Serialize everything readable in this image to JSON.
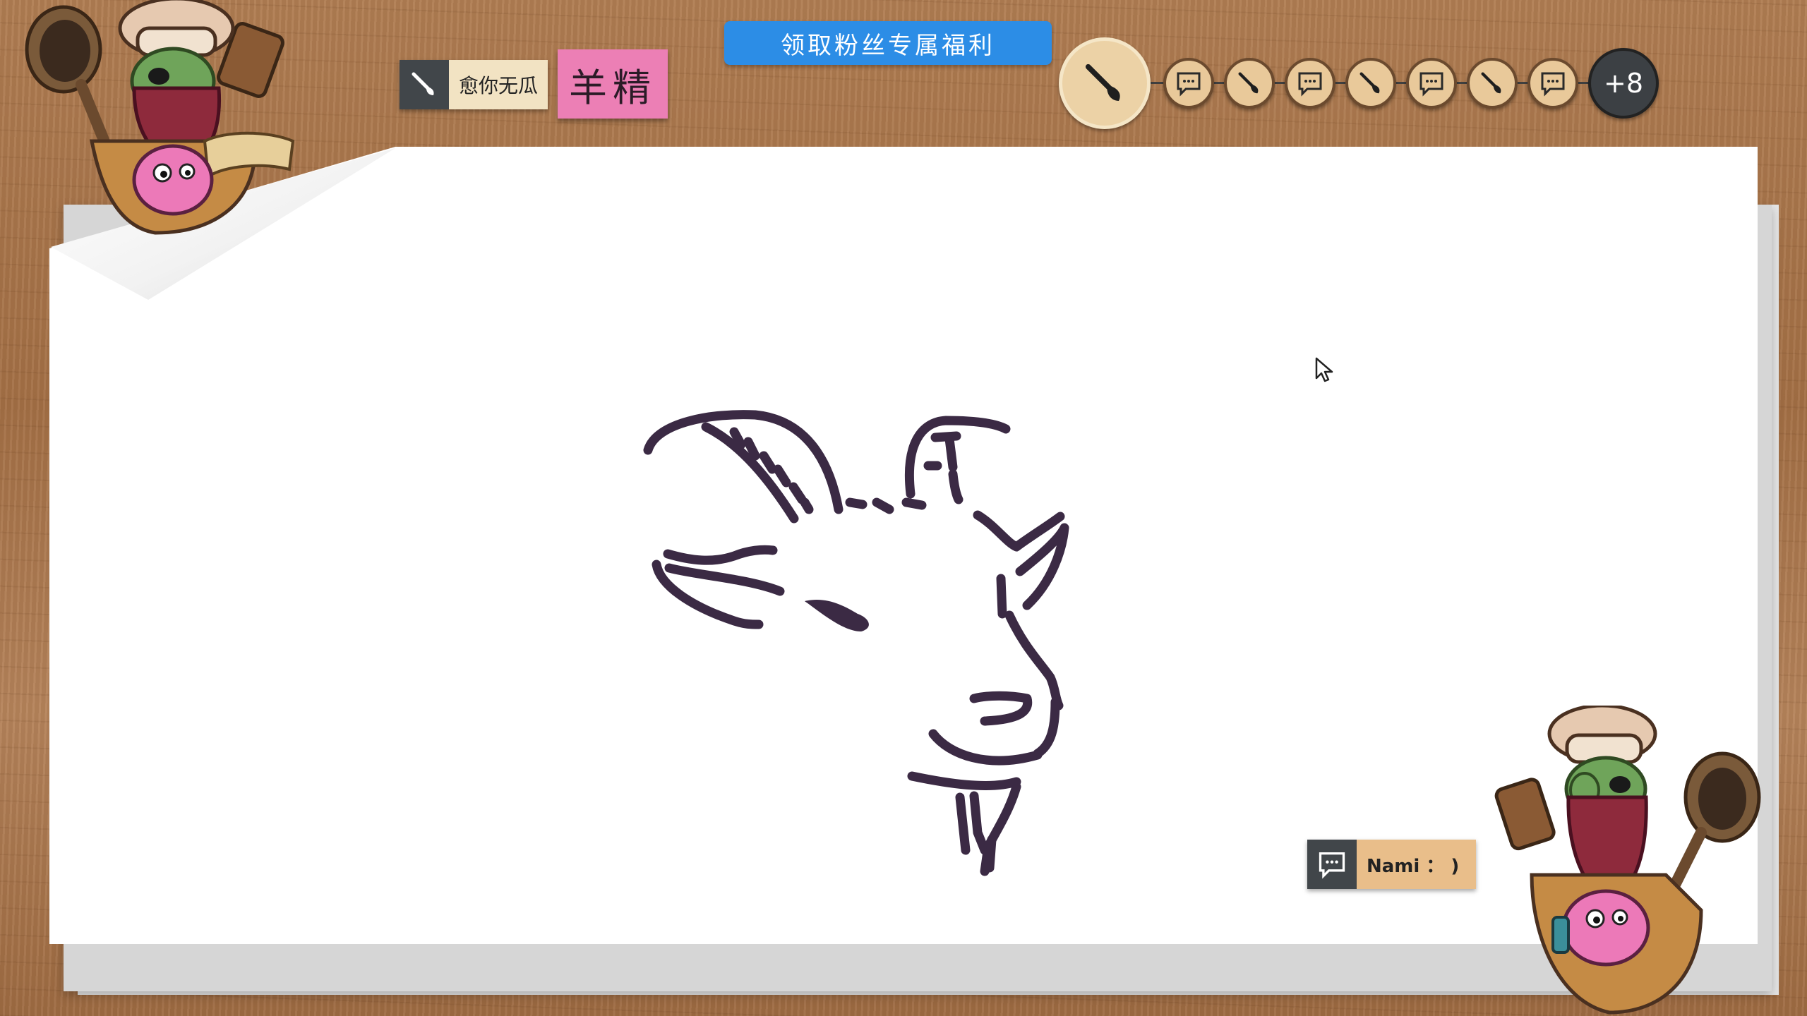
{
  "banner": {
    "label": "领取粉丝专属福利"
  },
  "current_drawer": {
    "name": "愈你无瓜",
    "icon": "brush-icon"
  },
  "word_hint": {
    "text": "羊精"
  },
  "player_queue": {
    "nodes": [
      {
        "type": "drawer",
        "icon": "brush-icon",
        "current": true
      },
      {
        "type": "chat",
        "icon": "chat-bubble-icon"
      },
      {
        "type": "drawer",
        "icon": "brush-icon"
      },
      {
        "type": "chat",
        "icon": "chat-bubble-icon"
      },
      {
        "type": "drawer",
        "icon": "brush-icon"
      },
      {
        "type": "chat",
        "icon": "chat-bubble-icon"
      },
      {
        "type": "drawer",
        "icon": "brush-icon"
      },
      {
        "type": "chat",
        "icon": "chat-bubble-icon"
      }
    ],
    "more_label": "+8"
  },
  "chat_message": {
    "icon": "chat-bubble-icon",
    "text": "Nami ： )"
  },
  "colors": {
    "stroke": "#3b2a44",
    "banner": "#2c8de6",
    "word_note": "#ec7fb5",
    "queue_node": "#e9c99a"
  }
}
